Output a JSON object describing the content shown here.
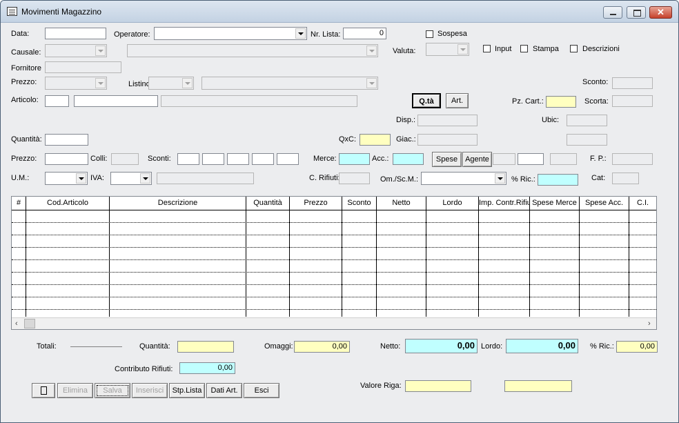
{
  "window": {
    "title": "Movimenti Magazzino"
  },
  "header": {
    "data_label": "Data:",
    "data_value": "",
    "operatore_label": "Operatore:",
    "operatore_value": "",
    "nrlista_label": "Nr. Lista:",
    "nrlista_value": "0",
    "sospesa_label": "Sospesa",
    "causale_label": "Causale:",
    "valuta_label": "Valuta:",
    "input_label": "Input",
    "stampa_label": "Stampa",
    "descrizioni_label": "Descrizioni",
    "fornitore_label": "Fornitore",
    "prezzo_label": "Prezzo:",
    "listino_label": "Listino:",
    "sconto_label": "Sconto:",
    "articolo_label": "Articolo:",
    "qta_button": "Q.tà",
    "art_button": "Art.",
    "pzcart_label": "Pz. Cart.:",
    "scorta_label": "Scorta:",
    "disp_label": "Disp.:",
    "ubic_label": "Ubic:",
    "quantita_label": "Quantità:",
    "qxc_label": "QxC:",
    "giac_label": "Giac.:",
    "prezzo2_label": "Prezzo:",
    "colli_label": "Colli:",
    "sconti_label": "Sconti:",
    "merce_label": "Merce:",
    "acc_label": "Acc.:",
    "spese_button": "Spese",
    "agente_button": "Agente",
    "fp_label": "F. P.:",
    "um_label": "U.M.:",
    "iva_label": "IVA:",
    "crifiuti_label": "C. Rifiuti:",
    "omscm_label": "Om./Sc.M.:",
    "ric_label": "% Ric.:",
    "cat_label": "Cat:"
  },
  "grid": {
    "columns": [
      "#",
      "Cod.Articolo",
      "Descrizione",
      "Quantità",
      "Prezzo",
      "Sconto",
      "Netto",
      "Lordo",
      "Imp. Contr.Rifiu",
      "Spese Merce",
      "Spese Acc.",
      "C.I."
    ]
  },
  "totals": {
    "totali_label": "Totali:",
    "quantita_label": "Quantità:",
    "quantita_value": "",
    "omaggi_label": "Omaggi:",
    "omaggi_value": "0,00",
    "netto_label": "Netto:",
    "netto_value": "0,00",
    "lordo_label": "Lordo:",
    "lordo_value": "0,00",
    "ric_label": "% Ric.:",
    "ric_value": "0,00",
    "contributo_label": "Contributo Rifiuti:",
    "contributo_value": "0,00",
    "valore_riga_label": "Valore Riga:"
  },
  "buttons": {
    "elimina": "Elimina",
    "salva": "Salva",
    "inserisci": "Inserisci",
    "stp_lista": "Stp.Lista",
    "dati_art": "Dati Art.",
    "esci": "Esci"
  }
}
